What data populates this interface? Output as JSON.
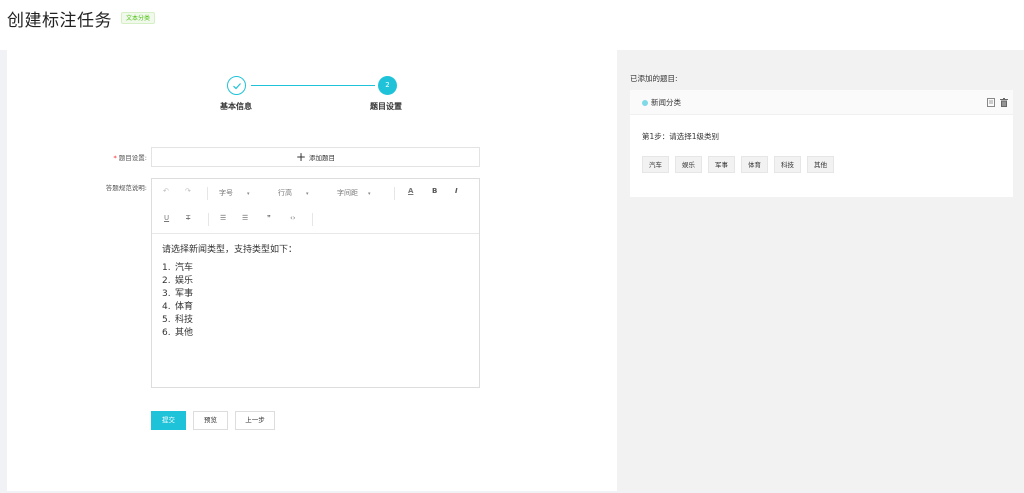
{
  "header": {
    "title": "创建标注任务",
    "type_tag": "文本分类"
  },
  "steps": [
    {
      "number": "",
      "label": "基本信息",
      "status": "done"
    },
    {
      "number": "2",
      "label": "题目设置",
      "status": "active"
    }
  ],
  "form": {
    "question_label": "题目设置:",
    "required_mark": "*",
    "add_question_label": "添加题目",
    "guide_label": "答题规范说明:"
  },
  "editor": {
    "toolbar": {
      "undo": "↶",
      "redo": "↷",
      "font_size": "字号",
      "line_height": "行高",
      "letter_spacing": "字间距",
      "caret": "▾",
      "font_color": "A",
      "bold": "B",
      "italic": "I",
      "underline": "U",
      "strikethrough": "T",
      "bullet_list": "☰",
      "ordered_list": "☰",
      "quote": "❞",
      "code": "‹›"
    },
    "content": {
      "intro": "请选择新闻类型，支持类型如下：",
      "items": [
        {
          "num": "1.",
          "text": "汽车"
        },
        {
          "num": "2.",
          "text": "娱乐"
        },
        {
          "num": "3.",
          "text": "军事"
        },
        {
          "num": "4.",
          "text": "体育"
        },
        {
          "num": "5.",
          "text": "科技"
        },
        {
          "num": "6.",
          "text": "其他"
        }
      ]
    }
  },
  "buttons": {
    "submit": "提交",
    "preview": "预览",
    "prev": "上一步"
  },
  "added": {
    "title": "已添加的题目:",
    "question": {
      "name": "新闻分类",
      "step_text": "第1步：请选择1级类别",
      "options": [
        "汽车",
        "娱乐",
        "军事",
        "体育",
        "科技",
        "其他"
      ]
    }
  },
  "colors": {
    "primary": "#1fc3d9",
    "tag_green": "#52c41a"
  }
}
